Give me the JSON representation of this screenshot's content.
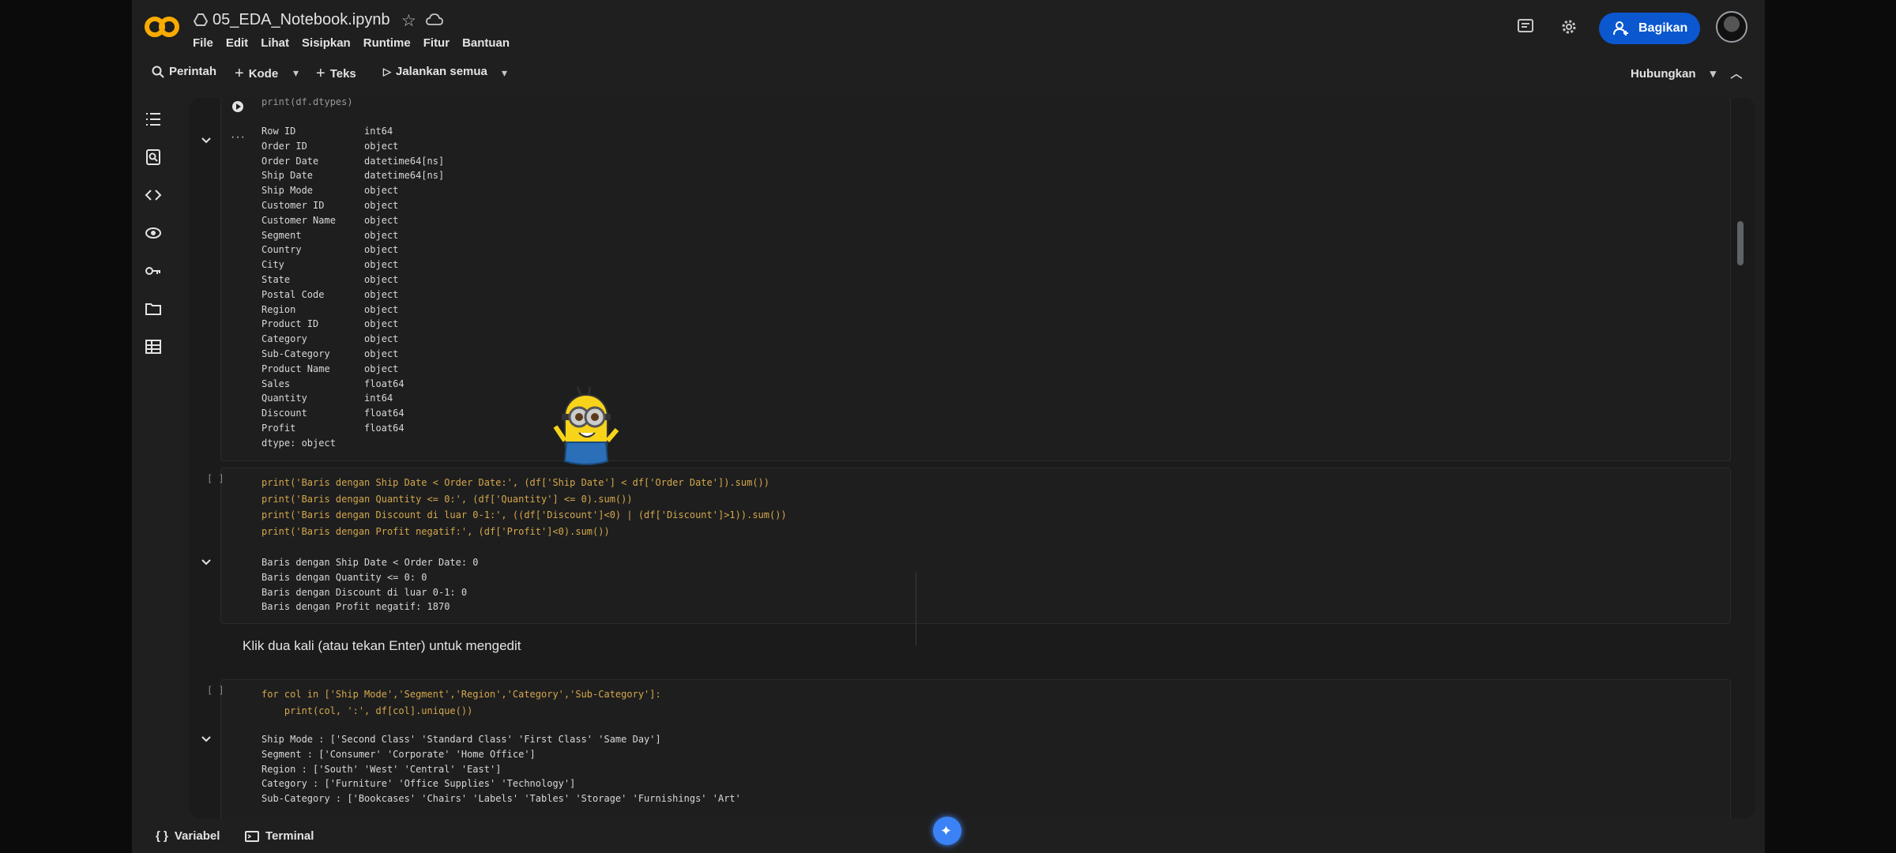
{
  "header": {
    "title": "05_EDA_Notebook.ipynb",
    "menu": [
      "File",
      "Edit",
      "Lihat",
      "Sisipkan",
      "Runtime",
      "Fitur",
      "Bantuan"
    ],
    "share_label": "Bagikan"
  },
  "toolbar": {
    "search_label": "Perintah",
    "code_label": "Kode",
    "text_label": "Teks",
    "run_all_label": "Jalankan semua",
    "connect_label": "Hubungkan"
  },
  "cells": {
    "cell1": {
      "code_top": "print(df.dtypes)",
      "output": [
        "Row ID            int64",
        "Order ID          object",
        "Order Date        datetime64[ns]",
        "Ship Date         datetime64[ns]",
        "Ship Mode         object",
        "Customer ID       object",
        "Customer Name     object",
        "Segment           object",
        "Country           object",
        "City              object",
        "State             object",
        "Postal Code       object",
        "Region            object",
        "Product ID        object",
        "Category          object",
        "Sub-Category      object",
        "Product Name      object",
        "Sales             float64",
        "Quantity          int64",
        "Discount          float64",
        "Profit            float64",
        "dtype: object"
      ]
    },
    "cell2": {
      "code": [
        "print('Baris dengan Ship Date < Order Date:', (df['Ship Date'] < df['Order Date']).sum())",
        "print('Baris dengan Quantity <= 0:', (df['Quantity'] <= 0).sum())",
        "print('Baris dengan Discount di luar 0-1:', ((df['Discount']<0) | (df['Discount']>1)).sum())",
        "print('Baris dengan Profit negatif:', (df['Profit']<0).sum())"
      ],
      "output": [
        "Baris dengan Ship Date < Order Date: 0",
        "Baris dengan Quantity <= 0: 0",
        "Baris dengan Discount di luar 0-1: 0",
        "Baris dengan Profit negatif: 1870"
      ]
    },
    "markdown": "Klik dua kali (atau tekan Enter) untuk mengedit",
    "cell3": {
      "code": [
        "for col in ['Ship Mode','Segment','Region','Category','Sub-Category']:",
        "    print(col, ':', df[col].unique())"
      ],
      "output": [
        "Ship Mode : ['Second Class' 'Standard Class' 'First Class' 'Same Day']",
        "Segment : ['Consumer' 'Corporate' 'Home Office']",
        "Region : ['South' 'West' 'Central' 'East']",
        "Category : ['Furniture' 'Office Supplies' 'Technology']",
        "Sub-Category : ['Bookcases' 'Chairs' 'Labels' 'Tables' 'Storage' 'Furnishings' 'Art'"
      ]
    }
  },
  "bottom": {
    "variables_label": "Variabel",
    "terminal_label": "Terminal"
  },
  "colors": {
    "accent": "#0b57d0",
    "logo_orange": "#f9ab00"
  }
}
